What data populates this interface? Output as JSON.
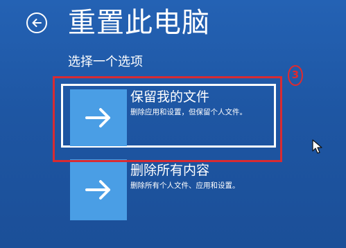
{
  "window": {
    "title": "重置此电脑"
  },
  "prompt": {
    "text": "选择一个选项"
  },
  "annotation": {
    "step": "3",
    "highlight_color": "#d82b32"
  },
  "options": [
    {
      "title": "保留我的文件",
      "description": "删除应用和设置，但保留个人文件。",
      "icon": "arrow-right-icon",
      "selected": true
    },
    {
      "title": "删除所有内容",
      "description": "删除所有个人文件、应用和设置。",
      "icon": "arrow-right-icon",
      "selected": false
    }
  ],
  "colors": {
    "background": "#1f57a5",
    "tile": "#4a9ee5",
    "text": "#ffffff"
  }
}
